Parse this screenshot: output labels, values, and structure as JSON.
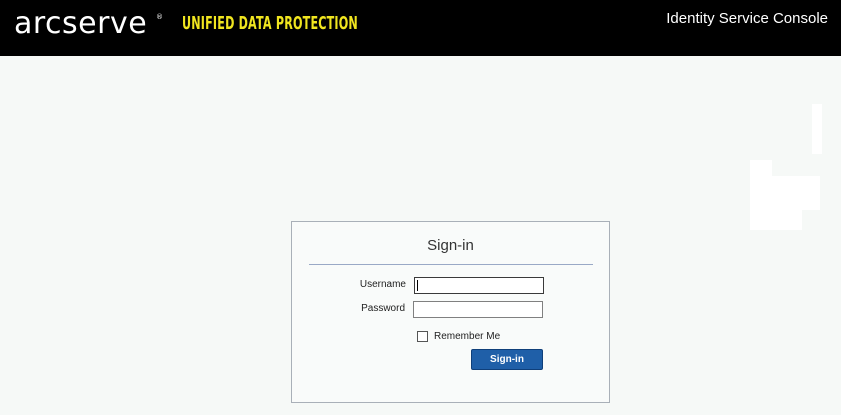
{
  "header": {
    "logo_text": "arcserve",
    "logo_mark": "®",
    "product_name": "UNIFIED DATA PROTECTION",
    "console_title": "Identity Service Console"
  },
  "signin": {
    "title": "Sign-in",
    "username_label": "Username",
    "username_value": "",
    "password_label": "Password",
    "password_value": "",
    "remember_label": "Remember Me",
    "remember_checked": false,
    "button_label": "Sign-in"
  },
  "colors": {
    "header_bg": "#000000",
    "product_name": "#f0e51f",
    "page_bg": "#f6f9f7",
    "button_bg": "#1f5fa8"
  }
}
